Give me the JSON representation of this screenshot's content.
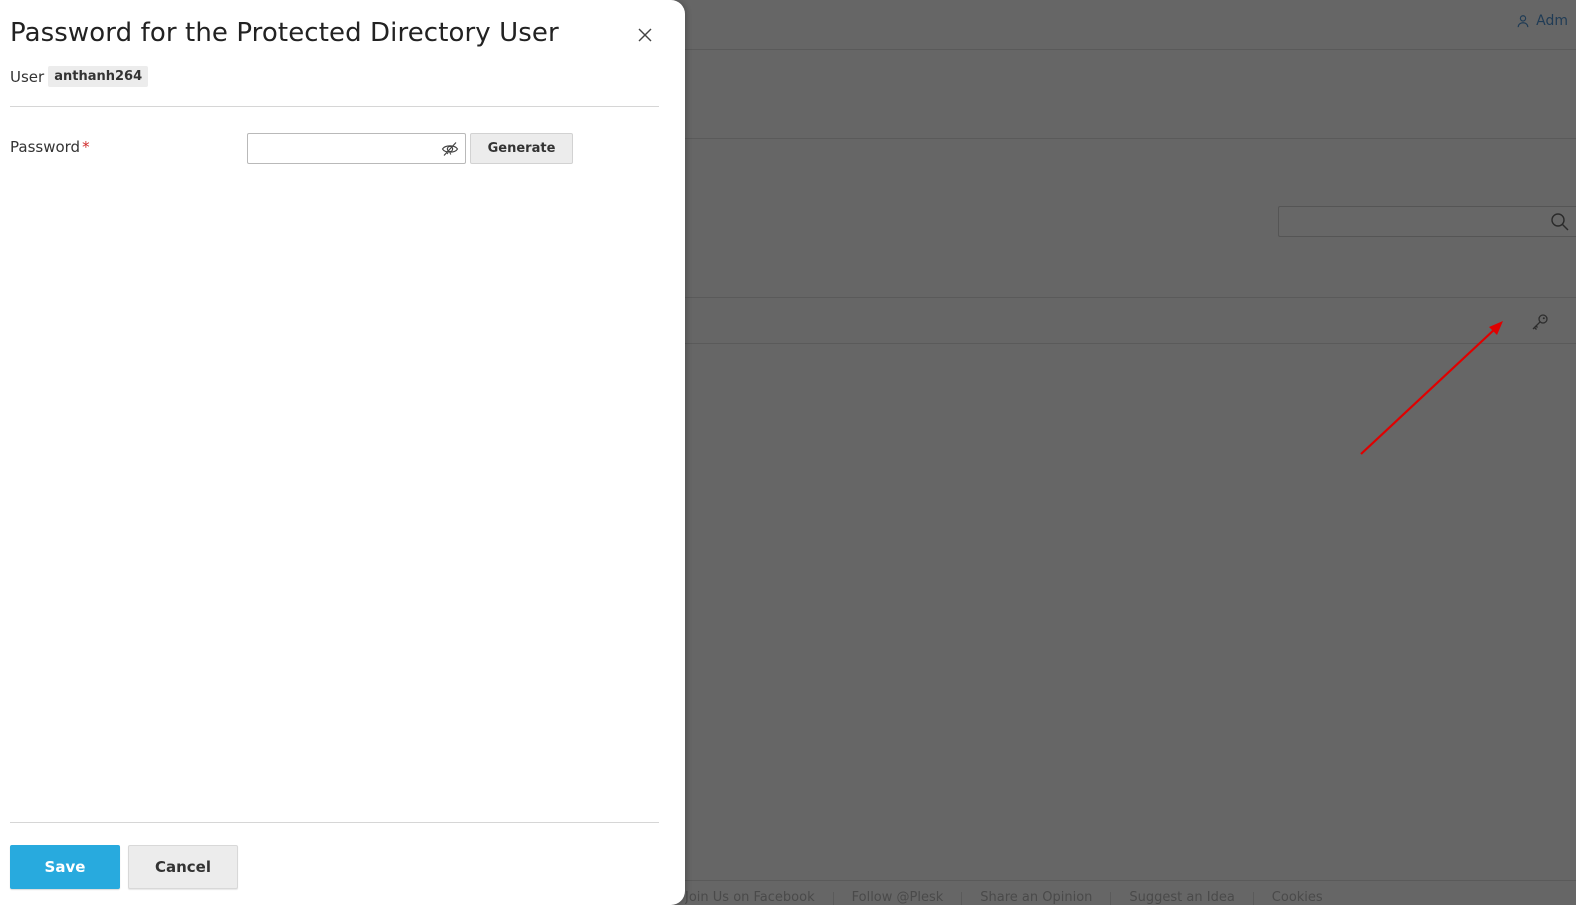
{
  "background": {
    "user_label": "Adm",
    "footer_links": [
      "Join Us on Facebook",
      "Follow @Plesk",
      "Share an Opinion",
      "Suggest an Idea",
      "Cookies"
    ],
    "user_icon": "user-icon",
    "search_icon": "search-icon",
    "key_icon": "key-icon"
  },
  "dialog": {
    "title": "Password for the Protected Directory User",
    "user_label": "User",
    "user_value": "anthanh264",
    "password_label": "Password",
    "required_mark": "*",
    "password_value": "",
    "generate_label": "Generate",
    "save_label": "Save",
    "cancel_label": "Cancel",
    "close_icon": "close-icon",
    "eye_icon": "eye-off-icon"
  },
  "colors": {
    "primary": "#28aade",
    "required": "#d02b2b",
    "overlay": "#666666",
    "annotation_arrow": "#e00000"
  }
}
